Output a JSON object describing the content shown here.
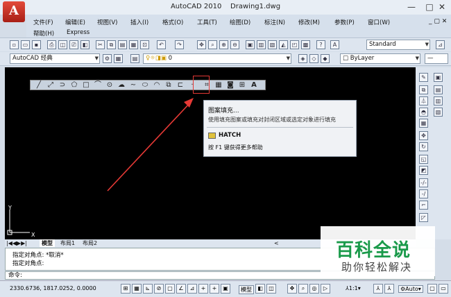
{
  "app": {
    "logo": "A",
    "title": "AutoCAD 2010",
    "doc": "Drawing1.dwg"
  },
  "window_controls": {
    "min": "—",
    "max": "□",
    "close": "✕"
  },
  "doc_controls": "_ ▢ ✕",
  "menu": [
    "文件(F)",
    "编辑(E)",
    "视图(V)",
    "插入(I)",
    "格式(O)",
    "工具(T)",
    "绘图(D)",
    "标注(N)",
    "修改(M)",
    "参数(P)",
    "窗口(W)",
    "帮助(H)",
    "Express"
  ],
  "toolbar": {
    "text_style": "Standard"
  },
  "toolbar2": {
    "workspace": "AutoCAD 经典",
    "layer": "0",
    "linetype": "ByLayer"
  },
  "draw_toolbar": {
    "icons": [
      "line-icon",
      "construction-line-icon",
      "polyline-icon",
      "polygon-icon",
      "rectangle-icon",
      "arc-icon",
      "circle-icon",
      "revcloud-icon",
      "spline-icon",
      "ellipse-icon",
      "ellipse-arc-icon",
      "insert-block-icon",
      "make-block-icon",
      "point-icon",
      "hatch-icon",
      "gradient-icon",
      "region-icon",
      "table-icon",
      "mtext-icon"
    ],
    "glyphs": [
      "╱",
      "⤢",
      "⊃",
      "⬠",
      "□",
      "⌒",
      "⊙",
      "☁",
      "∼",
      "⬭",
      "◠",
      "⧉",
      "⊏",
      "·",
      "⌗",
      "▦",
      "◙",
      "⊞",
      "A"
    ]
  },
  "tooltip": {
    "title": "图案填充...",
    "desc": "使用填充图案或填充对封闭区域或选定对象进行填充",
    "command": "HATCH",
    "help": "按 F1 键获得更多帮助"
  },
  "ucs": {
    "y": "Y",
    "x": "X"
  },
  "tabs": [
    "模型",
    "布局1",
    "布局2"
  ],
  "command_history": [
    "指定对角点: *取消*",
    "指定对角点:"
  ],
  "command_prompt": "命令:",
  "status": {
    "coords": "2330.6736, 1817.0252, 0.0000",
    "model": "模型",
    "scale": "1:1",
    "auto": "Auto"
  },
  "watermark": {
    "line1": "百科全说",
    "line2": "助你轻松解决"
  },
  "colors": {
    "accent": "#1a9a4a",
    "highlight": "#e53935"
  }
}
